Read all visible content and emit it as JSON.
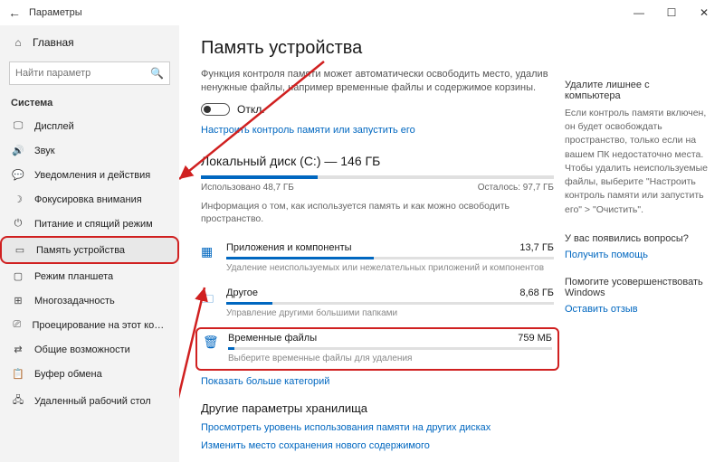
{
  "titlebar": {
    "back": "←",
    "title": "Параметры"
  },
  "home": {
    "label": "Главная"
  },
  "search": {
    "placeholder": "Найти параметр"
  },
  "sidebar": {
    "section": "Система",
    "items": [
      {
        "label": "Дисплей",
        "icon": "display"
      },
      {
        "label": "Звук",
        "icon": "sound"
      },
      {
        "label": "Уведомления и действия",
        "icon": "notify"
      },
      {
        "label": "Фокусировка внимания",
        "icon": "focus"
      },
      {
        "label": "Питание и спящий режим",
        "icon": "power"
      },
      {
        "label": "Память устройства",
        "icon": "storage",
        "selected": true
      },
      {
        "label": "Режим планшета",
        "icon": "tablet"
      },
      {
        "label": "Многозадачность",
        "icon": "multi"
      },
      {
        "label": "Проецирование на этот компьютер",
        "icon": "project"
      },
      {
        "label": "Общие возможности",
        "icon": "share"
      },
      {
        "label": "Буфер обмена",
        "icon": "clip"
      },
      {
        "label": "Удаленный рабочий стол",
        "icon": "remote"
      }
    ]
  },
  "main": {
    "title": "Память устройства",
    "desc": "Функция контроля памяти может автоматически освободить место, удалив ненужные файлы, например временные файлы и содержимое корзины.",
    "toggle_label": "Откл.",
    "config_link": "Настроить контроль памяти или запустить его",
    "disk_title": "Локальный диск (C:) — 146 ГБ",
    "used": "Использовано 48,7 ГБ",
    "free": "Осталось: 97,7 ГБ",
    "info": "Информация о том, как используется память и как можно освободить пространство.",
    "cats": [
      {
        "name": "Приложения и компоненты",
        "size": "13,7 ГБ",
        "sub": "Удаление неиспользуемых или нежелательных приложений и компонентов",
        "fill": 45
      },
      {
        "name": "Другое",
        "size": "8,68 ГБ",
        "sub": "Управление другими большими папками",
        "fill": 14
      },
      {
        "name": "Временные файлы",
        "size": "759 МБ",
        "sub": "Выберите временные файлы для удаления",
        "fill": 2,
        "highlight": true
      }
    ],
    "more": "Показать больше категорий",
    "other_title": "Другие параметры хранилища",
    "other_link1": "Просмотреть уровень использования памяти на других дисках",
    "other_link2": "Изменить место сохранения нового содержимого"
  },
  "right": {
    "r1_head": "Удалите лишнее с компьютера",
    "r1_body": "Если контроль памяти включен, он будет освобождать пространство, только если на вашем ПК недостаточно места. Чтобы удалить неиспользуемые файлы, выберите \"Настроить контроль памяти или запустить его\" > \"Очистить\".",
    "r2_head": "У вас появились вопросы?",
    "r2_link": "Получить помощь",
    "r3_head": "Помогите усовершенствовать Windows",
    "r3_link": "Оставить отзыв"
  }
}
